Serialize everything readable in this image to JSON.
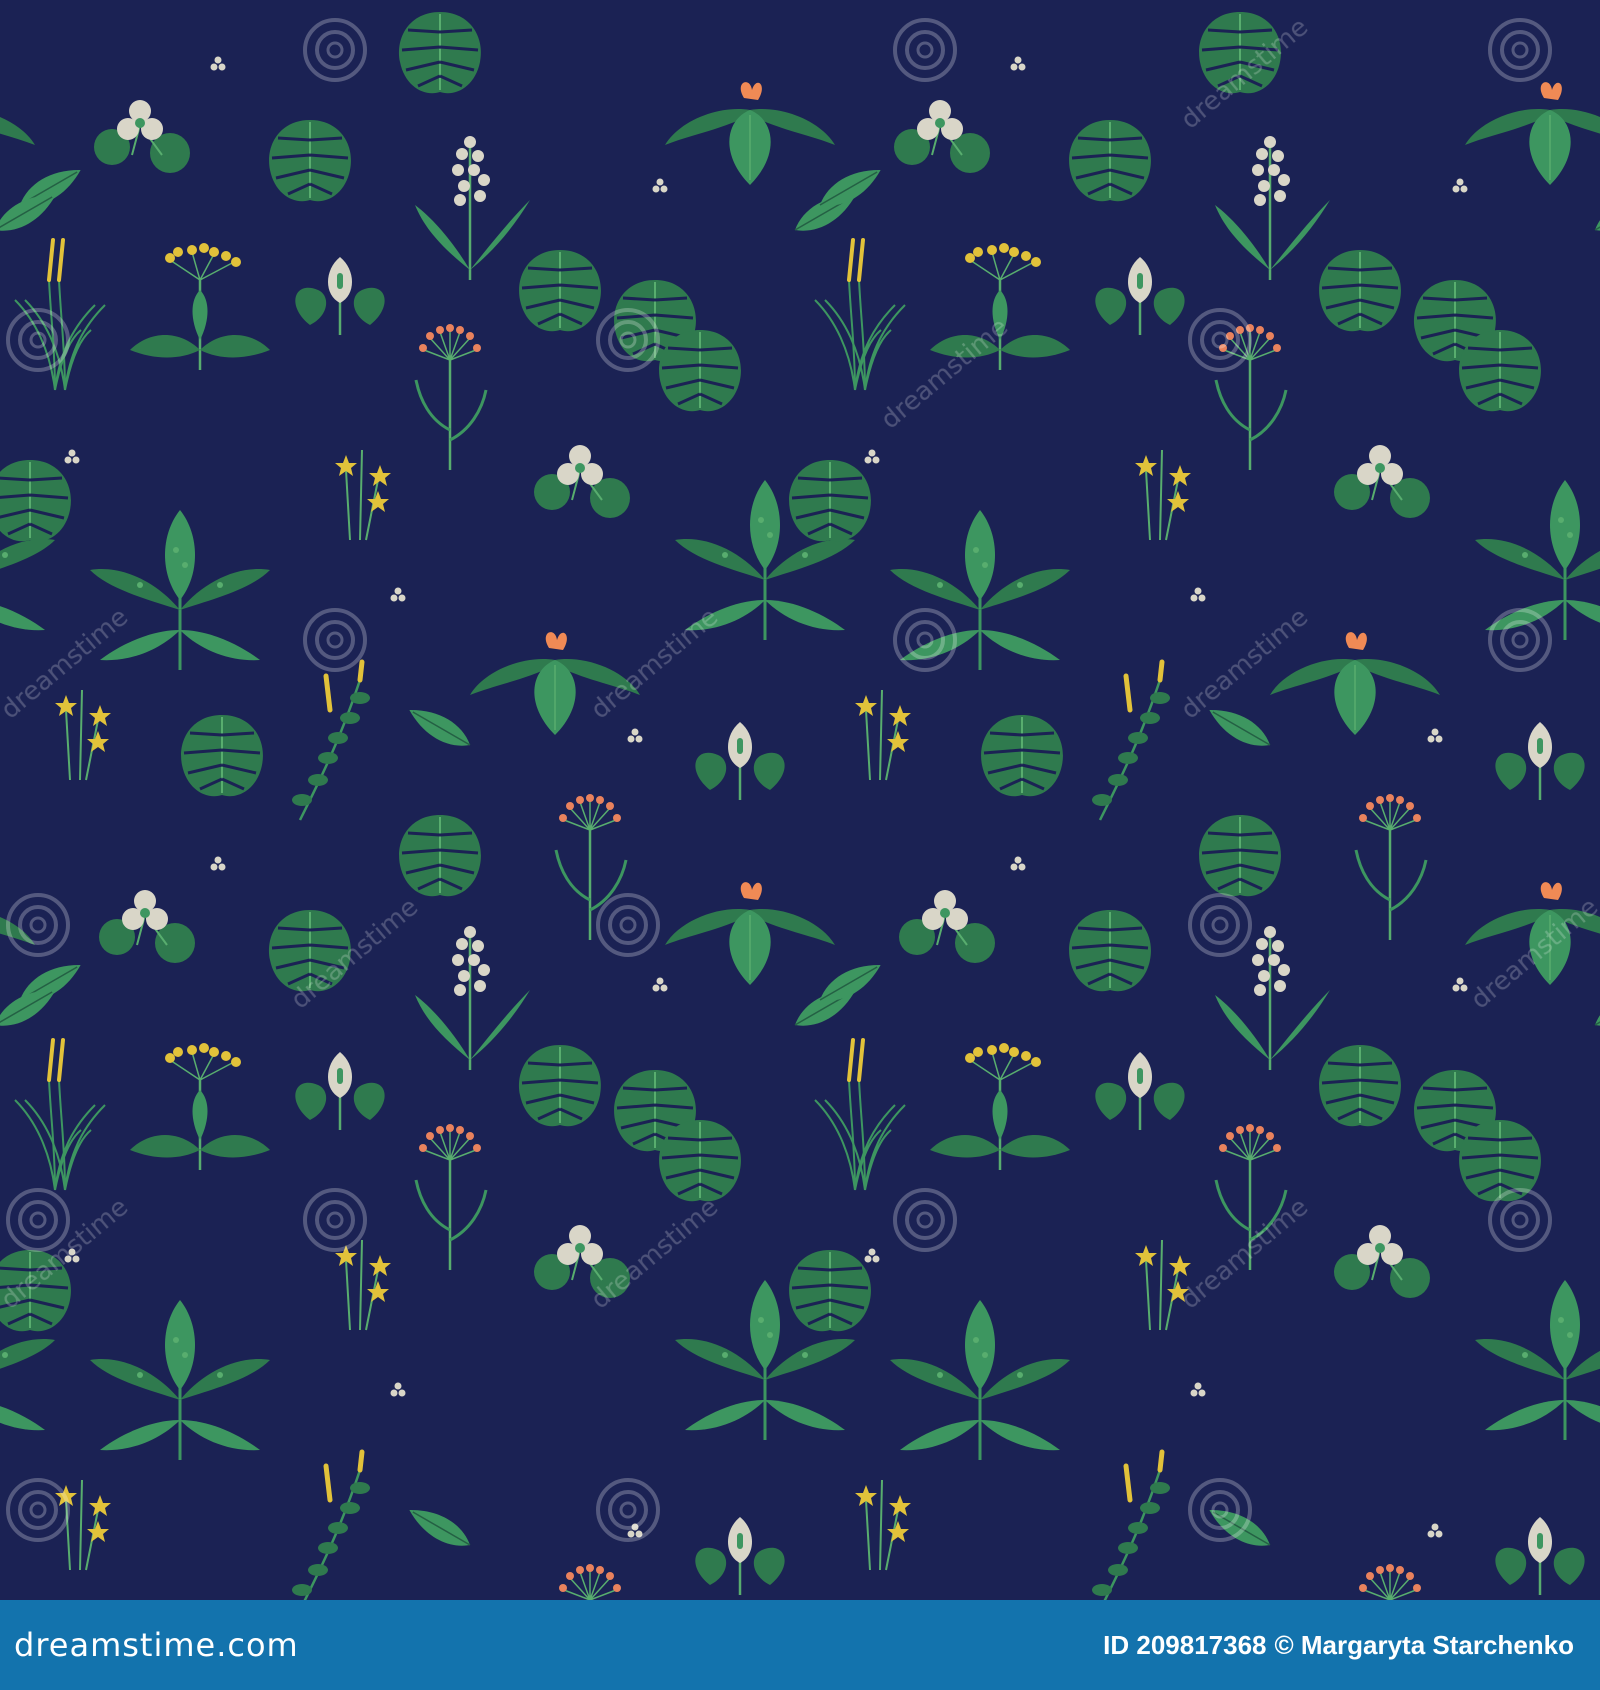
{
  "pattern": {
    "background": "#1b2254",
    "leaf_colors": [
      "#2f7a4e",
      "#3d9660",
      "#58ad6e",
      "#246044"
    ],
    "flower_colors": {
      "white": "#d9d6c8",
      "yellow": "#e2c23a",
      "orange": "#f08a55",
      "salmon": "#e9825d"
    },
    "motifs": [
      "monstera-leaf",
      "arrowhead-plant",
      "white-trillium-flower",
      "yellow-star-flower",
      "umbel-flower",
      "spadix-flower",
      "grass-spike",
      "round-pad-leaves"
    ]
  },
  "watermark": {
    "logo_text": "dreamstime"
  },
  "footer": {
    "brand": "dreamstime.com",
    "id_label": "ID 209817368",
    "copyright": "© Margaryta Starchenko",
    "background": "#1373ad"
  }
}
